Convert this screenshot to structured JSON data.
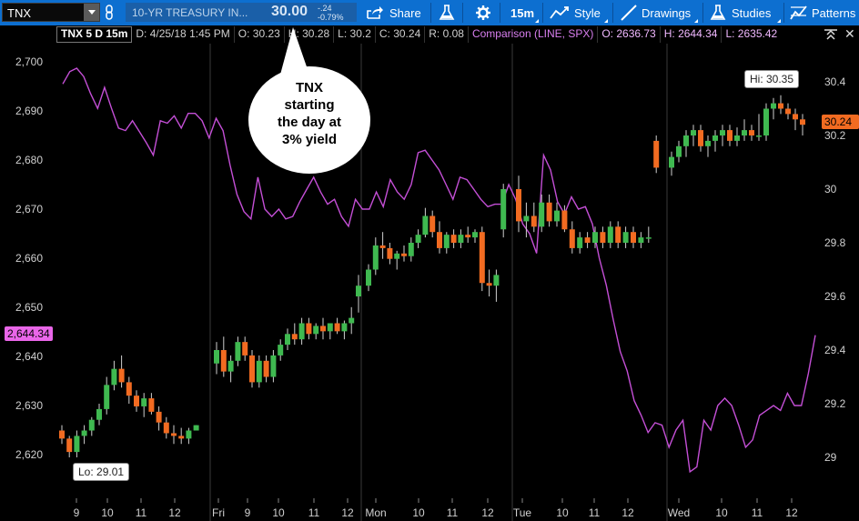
{
  "toolbar": {
    "symbol": "TNX",
    "description": "10-YR TREASURY IN...",
    "last_price": "30.00",
    "change": "-.24",
    "change_pct": "-0.79%",
    "share_label": "Share",
    "timeframe_label": "15m",
    "style_label": "Style",
    "drawings_label": "Drawings",
    "studies_label": "Studies",
    "patterns_label": "Patterns"
  },
  "infobar": {
    "symbol_period": "TNX 5 D 15m",
    "date": "D: 4/25/18 1:45 PM",
    "open": "O: 30.23",
    "high": "H: 30.28",
    "low": "L: 30.2",
    "close": "C: 30.24",
    "range": "R: 0.08",
    "comparison": "Comparison (LINE, SPX)",
    "cmp_open": "O: 2636.73",
    "cmp_high": "H: 2644.34",
    "cmp_low": "L: 2635.42"
  },
  "annotations": {
    "bubble_lines": [
      "TNX",
      "starting",
      "the day at",
      "3% yield"
    ],
    "hi_label": "Hi: 30.35",
    "lo_label": "Lo: 29.01",
    "left_price_tag": "2,644.34",
    "right_price_tag": "30.24"
  },
  "colors": {
    "toolbar_bg": "#0d6fd0",
    "up_candle": "#3fb950",
    "down_candle": "#f26b21",
    "comparison_line": "#c44fd6",
    "left_tag_bg": "#e966e8",
    "right_tag_bg": "#f26b21"
  },
  "icons": [
    "chevron-down-icon",
    "link-icon",
    "share-icon",
    "flask-icon",
    "gear-icon",
    "style-icon",
    "pencil-icon",
    "studies-icon",
    "patterns-icon",
    "collapse-icon",
    "close-icon"
  ],
  "chart_data": {
    "type": "candlestick",
    "left_axis": {
      "series": "SPX",
      "ticks": [
        "2,700",
        "2,690",
        "2,680",
        "2,670",
        "2,660",
        "2,650",
        "2,640",
        "2,630",
        "2,620"
      ],
      "ylim": [
        2615,
        2702
      ]
    },
    "right_axis": {
      "series": "TNX",
      "ticks": [
        "30.4",
        "30.2",
        "30",
        "29.8",
        "29.6",
        "29.4",
        "29.2",
        "29"
      ],
      "ylim": [
        28.85,
        30.5
      ]
    },
    "x_ticks": [
      "9",
      "10",
      "11",
      "12",
      "Fri",
      "9",
      "10",
      "11",
      "12",
      "Mon",
      "10",
      "11",
      "12",
      "Tue",
      "10",
      "11",
      "12",
      "Wed",
      "10",
      "11",
      "12"
    ],
    "series": [
      {
        "name": "TNX",
        "kind": "candles",
        "candles": [
          [
            29.1,
            29.12,
            29.05,
            29.07
          ],
          [
            29.07,
            29.08,
            29.0,
            29.02
          ],
          [
            29.02,
            29.1,
            29.0,
            29.08
          ],
          [
            29.08,
            29.12,
            29.05,
            29.1
          ],
          [
            29.1,
            29.15,
            29.08,
            29.14
          ],
          [
            29.14,
            29.2,
            29.12,
            29.18
          ],
          [
            29.18,
            29.3,
            29.16,
            29.27
          ],
          [
            29.27,
            29.36,
            29.25,
            29.33
          ],
          [
            29.33,
            29.38,
            29.26,
            29.28
          ],
          [
            29.28,
            29.3,
            29.2,
            29.23
          ],
          [
            29.23,
            29.25,
            29.17,
            29.19
          ],
          [
            29.19,
            29.24,
            29.15,
            29.22
          ],
          [
            29.22,
            29.24,
            29.16,
            29.17
          ],
          [
            29.17,
            29.19,
            29.1,
            29.13
          ],
          [
            29.13,
            29.15,
            29.07,
            29.09
          ],
          [
            29.09,
            29.12,
            29.05,
            29.08
          ],
          [
            29.08,
            29.11,
            29.05,
            29.07
          ],
          [
            29.07,
            29.11,
            29.05,
            29.1
          ],
          [
            29.1,
            29.12,
            29.1,
            29.12
          ],
          [
            29.35,
            29.43,
            29.31,
            29.4
          ],
          [
            29.4,
            29.45,
            29.3,
            29.32
          ],
          [
            29.32,
            29.38,
            29.28,
            29.36
          ],
          [
            29.36,
            29.45,
            29.34,
            29.43
          ],
          [
            29.43,
            29.45,
            29.36,
            29.38
          ],
          [
            29.38,
            29.4,
            29.26,
            29.28
          ],
          [
            29.28,
            29.38,
            29.26,
            29.36
          ],
          [
            29.36,
            29.38,
            29.28,
            29.3
          ],
          [
            29.3,
            29.4,
            29.28,
            29.38
          ],
          [
            29.38,
            29.44,
            29.36,
            29.42
          ],
          [
            29.42,
            29.48,
            29.4,
            29.46
          ],
          [
            29.46,
            29.5,
            29.42,
            29.44
          ],
          [
            29.44,
            29.52,
            29.42,
            29.5
          ],
          [
            29.5,
            29.52,
            29.44,
            29.46
          ],
          [
            29.46,
            29.5,
            29.44,
            29.49
          ],
          [
            29.49,
            29.52,
            29.44,
            29.47
          ],
          [
            29.47,
            29.5,
            29.44,
            29.5
          ],
          [
            29.5,
            29.52,
            29.46,
            29.47
          ],
          [
            29.47,
            29.51,
            29.44,
            29.5
          ],
          [
            29.5,
            29.56,
            29.46,
            29.52
          ],
          [
            29.6,
            29.68,
            29.54,
            29.64
          ],
          [
            29.64,
            29.72,
            29.62,
            29.7
          ],
          [
            29.7,
            29.82,
            29.68,
            29.79
          ],
          [
            29.79,
            29.84,
            29.74,
            29.78
          ],
          [
            29.78,
            29.8,
            29.72,
            29.74
          ],
          [
            29.74,
            29.77,
            29.7,
            29.76
          ],
          [
            29.76,
            29.79,
            29.73,
            29.75
          ],
          [
            29.75,
            29.82,
            29.73,
            29.8
          ],
          [
            29.8,
            29.85,
            29.78,
            29.83
          ],
          [
            29.83,
            29.93,
            29.82,
            29.9
          ],
          [
            29.9,
            29.92,
            29.82,
            29.84
          ],
          [
            29.84,
            29.88,
            29.76,
            29.78
          ],
          [
            29.78,
            29.84,
            29.76,
            29.83
          ],
          [
            29.83,
            29.85,
            29.78,
            29.8
          ],
          [
            29.8,
            29.85,
            29.78,
            29.83
          ],
          [
            29.83,
            29.86,
            29.8,
            29.82
          ],
          [
            29.82,
            29.85,
            29.8,
            29.84
          ],
          [
            29.84,
            29.86,
            29.62,
            29.65
          ],
          [
            29.65,
            29.7,
            29.6,
            29.64
          ],
          [
            29.64,
            29.7,
            29.58,
            29.68
          ],
          [
            29.85,
            30.02,
            29.82,
            30.0
          ],
          [
            30.0,
            30.05,
            29.84,
            29.88
          ],
          [
            29.88,
            29.95,
            29.82,
            29.9
          ],
          [
            29.9,
            29.95,
            29.84,
            29.86
          ],
          [
            29.86,
            29.98,
            29.84,
            29.95
          ],
          [
            29.95,
            29.98,
            29.86,
            29.88
          ],
          [
            29.88,
            29.95,
            29.86,
            29.92
          ],
          [
            29.92,
            29.94,
            29.84,
            29.85
          ],
          [
            29.85,
            29.88,
            29.76,
            29.78
          ],
          [
            29.78,
            29.84,
            29.76,
            29.82
          ],
          [
            29.82,
            29.84,
            29.78,
            29.8
          ],
          [
            29.8,
            29.86,
            29.78,
            29.84
          ],
          [
            29.84,
            29.86,
            29.78,
            29.8
          ],
          [
            29.8,
            29.88,
            29.78,
            29.86
          ],
          [
            29.86,
            29.88,
            29.78,
            29.8
          ],
          [
            29.8,
            29.86,
            29.78,
            29.84
          ],
          [
            29.84,
            29.86,
            29.78,
            29.8
          ],
          [
            29.8,
            29.84,
            29.78,
            29.82
          ],
          [
            29.82,
            29.86,
            29.8,
            29.82
          ],
          [
            30.18,
            30.2,
            30.06,
            30.08
          ],
          [
            30.08,
            30.14,
            30.05,
            30.12
          ],
          [
            30.12,
            30.18,
            30.1,
            30.16
          ],
          [
            30.16,
            30.22,
            30.12,
            30.2
          ],
          [
            30.2,
            30.24,
            30.16,
            30.22
          ],
          [
            30.22,
            30.24,
            30.14,
            30.16
          ],
          [
            30.16,
            30.2,
            30.12,
            30.18
          ],
          [
            30.18,
            30.22,
            30.14,
            30.2
          ],
          [
            30.2,
            30.24,
            30.16,
            30.22
          ],
          [
            30.22,
            30.24,
            30.16,
            30.18
          ],
          [
            30.18,
            30.23,
            30.16,
            30.2
          ],
          [
            30.2,
            30.26,
            30.18,
            30.22
          ],
          [
            30.22,
            30.24,
            30.18,
            30.2
          ],
          [
            30.2,
            30.28,
            30.18,
            30.2
          ],
          [
            30.2,
            30.32,
            30.18,
            30.3
          ],
          [
            30.3,
            30.34,
            30.26,
            30.32
          ],
          [
            30.32,
            30.35,
            30.28,
            30.3
          ],
          [
            30.3,
            30.32,
            30.26,
            30.28
          ],
          [
            30.28,
            30.3,
            30.22,
            30.26
          ],
          [
            30.26,
            30.28,
            30.2,
            30.24
          ]
        ]
      },
      {
        "name": "SPX",
        "kind": "line",
        "values": [
          2695.5,
          2698.0,
          2698.7,
          2697.0,
          2693.5,
          2690.5,
          2694.8,
          2690.5,
          2686.5,
          2686.0,
          2688.0,
          2685.8,
          2683.5,
          2681.0,
          2688.0,
          2687.5,
          2689.0,
          2686.5,
          2689.5,
          2689.5,
          2688.0,
          2684.5,
          2688.5,
          2686.0,
          2679.0,
          2673.0,
          2669.5,
          2668.0,
          2676.5,
          2670.0,
          2668.5,
          2670.0,
          2668.0,
          2668.5,
          2671.5,
          2674.0,
          2676.5,
          2673.5,
          2671.0,
          2672.0,
          2668.5,
          2666.5,
          2672.0,
          2670.0,
          2670.0,
          2673.5,
          2670.5,
          2676.0,
          2673.5,
          2672.0,
          2675.0,
          2681.5,
          2682.0,
          2680.0,
          2678.0,
          2675.0,
          2672.0,
          2676.5,
          2676.0,
          2674.0,
          2672.0,
          2670.5,
          2671.0,
          2671.0,
          2675.0,
          2672.0,
          2667.0,
          2665.0,
          2661.0,
          2681.0,
          2678.0,
          2671.5,
          2669.0,
          2672.5,
          2670.0,
          2670.5,
          2667.0,
          2660.0,
          2654.5,
          2647.5,
          2641.0,
          2637.0,
          2631.0,
          2628.0,
          2624.5,
          2626.5,
          2626.0,
          2621.5,
          2625.0,
          2627.0,
          2616.5,
          2617.5,
          2627.0,
          2625.0,
          2630.0,
          2631.5,
          2630.0,
          2626.0,
          2621.5,
          2623.0,
          2628.0,
          2629.0,
          2630.0,
          2629.0,
          2632.5,
          2630.0,
          2630.0,
          2636.5,
          2644.34
        ]
      }
    ]
  }
}
